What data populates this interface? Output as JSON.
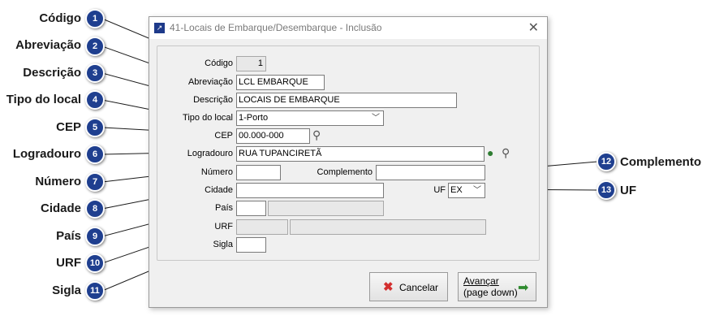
{
  "window": {
    "title": "41-Locais de Embarque/Desembarque - Inclusão"
  },
  "callouts": [
    {
      "num": "1",
      "label": "Código"
    },
    {
      "num": "2",
      "label": "Abreviação"
    },
    {
      "num": "3",
      "label": "Descrição"
    },
    {
      "num": "4",
      "label": "Tipo do local"
    },
    {
      "num": "5",
      "label": "CEP"
    },
    {
      "num": "6",
      "label": "Logradouro"
    },
    {
      "num": "7",
      "label": "Número"
    },
    {
      "num": "8",
      "label": "Cidade"
    },
    {
      "num": "9",
      "label": "País"
    },
    {
      "num": "10",
      "label": "URF"
    },
    {
      "num": "11",
      "label": "Sigla"
    },
    {
      "num": "12",
      "label": "Complemento"
    },
    {
      "num": "13",
      "label": "UF"
    }
  ],
  "form": {
    "codigo": {
      "label": "Código",
      "value": "1"
    },
    "abreviacao": {
      "label": "Abreviação",
      "value": "LCL EMBARQUE"
    },
    "descricao": {
      "label": "Descrição",
      "value": "LOCAIS DE EMBARQUE"
    },
    "tipo_local": {
      "label": "Tipo do local",
      "value": "1-Porto"
    },
    "cep": {
      "label": "CEP",
      "value": "00.000-000"
    },
    "logradouro": {
      "label": "Logradouro",
      "value": "RUA TUPANCIRETÃ"
    },
    "numero": {
      "label": "Número",
      "value": ""
    },
    "complemento": {
      "label": "Complemento",
      "value": ""
    },
    "cidade": {
      "label": "Cidade",
      "value": ""
    },
    "uf": {
      "label": "UF",
      "value": "EX"
    },
    "pais": {
      "label": "País",
      "value": ""
    },
    "urf": {
      "label": "URF",
      "value": ""
    },
    "sigla": {
      "label": "Sigla",
      "value": ""
    }
  },
  "buttons": {
    "cancel": "Cancelar",
    "next_line1": "Avançar",
    "next_line2": "(page down)"
  },
  "icons": {
    "accent": "#1f3f8f",
    "cancel_icon": "red-x-icon",
    "next_icon": "green-arrow-right-icon"
  }
}
